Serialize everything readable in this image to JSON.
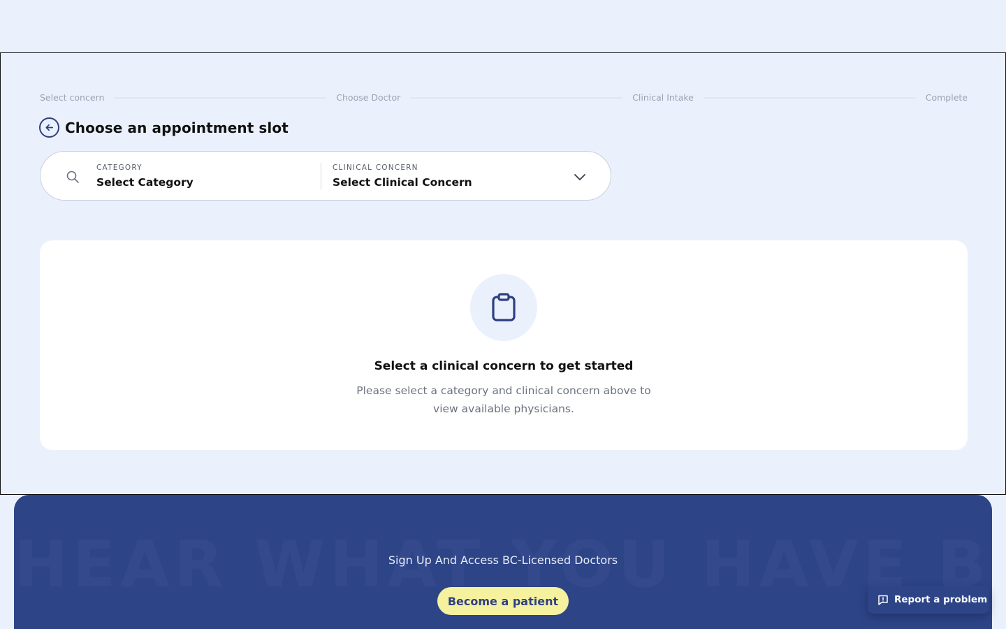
{
  "stepper": {
    "steps": [
      {
        "label": "Select concern"
      },
      {
        "label": "Choose Doctor"
      },
      {
        "label": "Clinical Intake"
      },
      {
        "label": "Complete"
      }
    ]
  },
  "header": {
    "title": "Choose an appointment slot",
    "back_icon": "arrow-left-circle-icon"
  },
  "selector": {
    "search_icon": "search-icon",
    "category": {
      "caption": "CATEGORY",
      "value": "Select Category"
    },
    "concern": {
      "caption": "CLINICAL CONCERN",
      "value": "Select Clinical Concern"
    },
    "chevron_icon": "chevron-down-icon"
  },
  "empty_state": {
    "icon": "clipboard-icon",
    "heading": "Select a clinical concern to get started",
    "text": "Please select a category and clinical concern above to view available physicians."
  },
  "footer": {
    "background_text": "HEAR WHAT YOU HAVE BEEN MISSING",
    "tagline": "Sign Up And Access BC-Licensed Doctors",
    "cta_label": "Become a patient"
  },
  "report": {
    "icon": "message-alert-icon",
    "label": "Report a problem"
  },
  "colors": {
    "page_bg": "#ebf1fc",
    "brand_navy": "#2d4486",
    "accent_yellow": "#f5f19e",
    "muted_text": "#6b7280"
  }
}
